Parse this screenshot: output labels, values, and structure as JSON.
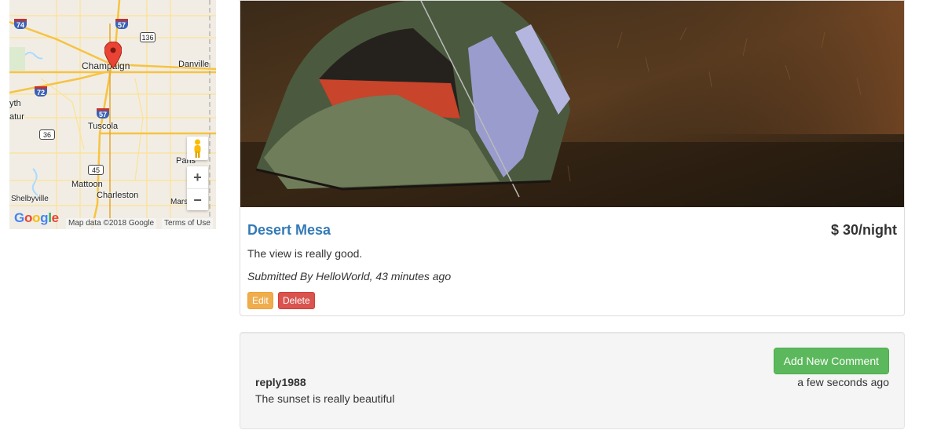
{
  "map": {
    "cities": {
      "champaign": "Champaign",
      "danville": "Danville",
      "tuscola": "Tuscola",
      "mattoon": "Mattoon",
      "charleston": "Charleston",
      "shelbyville": "Shelbyville",
      "paris": "Paris",
      "marshall": "Mars",
      "decatur": "atur",
      "monticello": "yth"
    },
    "shields": {
      "i74": "74",
      "i57_top": "57",
      "us136": "136",
      "i72": "72",
      "i57_mid": "57",
      "us36": "36",
      "us45": "45"
    },
    "zoom_in": "+",
    "zoom_out": "−",
    "logo": [
      "G",
      "o",
      "o",
      "g",
      "l",
      "e"
    ],
    "map_data": "Map data ©2018 Google",
    "terms": "Terms of Use",
    "pin_color": "#ea4335"
  },
  "campground": {
    "name": "Desert Mesa",
    "price": "$ 30/night",
    "description": "The view is really good.",
    "submitted": "Submitted By HelloWorld, 43 minutes ago",
    "edit_label": "Edit",
    "delete_label": "Delete"
  },
  "comments": {
    "add_label": "Add New Comment",
    "items": [
      {
        "author": "reply1988",
        "time": "a few seconds ago",
        "text": "The sunset is really beautiful"
      }
    ]
  },
  "colors": {
    "link": "#337ab7",
    "warning": "#f0ad4e",
    "danger": "#d9534f",
    "success": "#5cb85c"
  }
}
